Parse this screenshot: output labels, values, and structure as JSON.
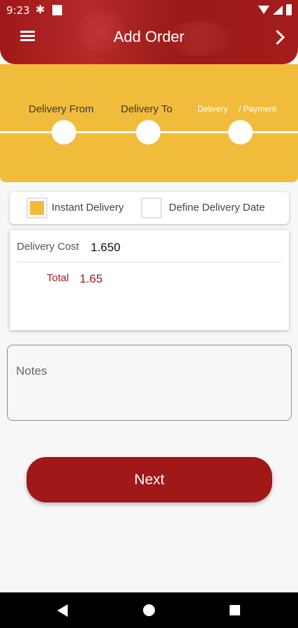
{
  "status_bar": {
    "time": "9:23",
    "icons": [
      "gear-icon",
      "notification-square-icon",
      "wifi-icon",
      "signal-icon",
      "battery-icon"
    ]
  },
  "header": {
    "title": "Add Order",
    "menu_icon": "hamburger-menu-icon",
    "forward_icon": "chevron-right-icon"
  },
  "stepper": {
    "steps": [
      {
        "label": "Delivery From"
      },
      {
        "label": "Delivery To"
      },
      {
        "label": "Delivery",
        "label_secondary": "/ Payment"
      }
    ]
  },
  "delivery_options": {
    "instant": {
      "label": "Instant Delivery",
      "checked": true
    },
    "define_date": {
      "label": "Define Delivery Date",
      "checked": false
    }
  },
  "cost": {
    "delivery_cost_label": "Delivery Cost",
    "delivery_cost_value": "1.650",
    "total_label": "Total",
    "total_value": "1.65"
  },
  "notes": {
    "placeholder": "Notes",
    "value": ""
  },
  "actions": {
    "next_label": "Next"
  },
  "colors": {
    "primary": "#a01818",
    "accent": "#f1bc3c",
    "total_text": "#9e1b1b"
  },
  "nav_bar": {
    "icons": [
      "back-icon",
      "home-icon",
      "recents-icon"
    ]
  }
}
